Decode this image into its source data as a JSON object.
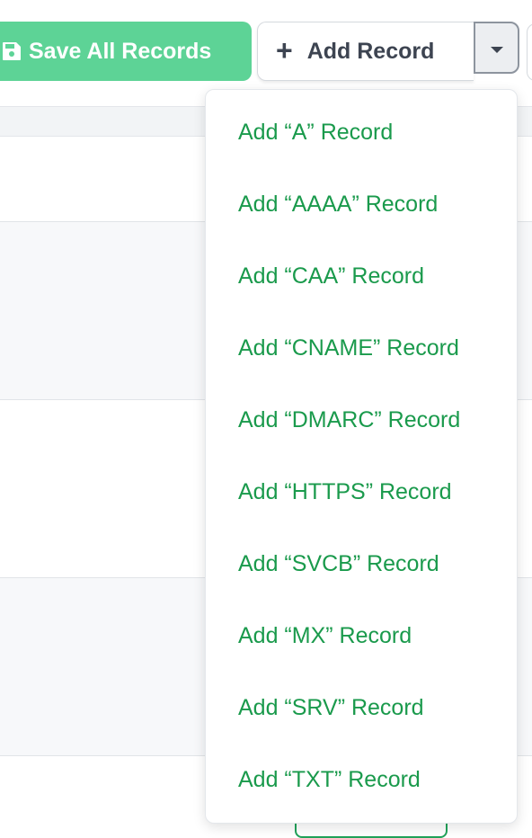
{
  "toolbar": {
    "save_label": "Save All Records",
    "save_icon": "floppy-disk-icon",
    "add_record_label": "Add Record",
    "add_record_icon": "plus-icon",
    "dropdown_icon": "caret-down-icon"
  },
  "add_record_menu": {
    "items": [
      {
        "label": "Add “A” Record"
      },
      {
        "label": "Add “AAAA” Record"
      },
      {
        "label": "Add “CAA” Record"
      },
      {
        "label": "Add “CNAME” Record"
      },
      {
        "label": "Add “DMARC” Record"
      },
      {
        "label": "Add “HTTPS” Record"
      },
      {
        "label": "Add “SVCB” Record"
      },
      {
        "label": "Add “MX” Record"
      },
      {
        "label": "Add “SRV” Record"
      },
      {
        "label": "Add “TXT” Record"
      }
    ]
  },
  "colors": {
    "save_button_bg": "#5dd396",
    "menu_text": "#1a9a4c",
    "add_record_text": "#3d4451"
  }
}
